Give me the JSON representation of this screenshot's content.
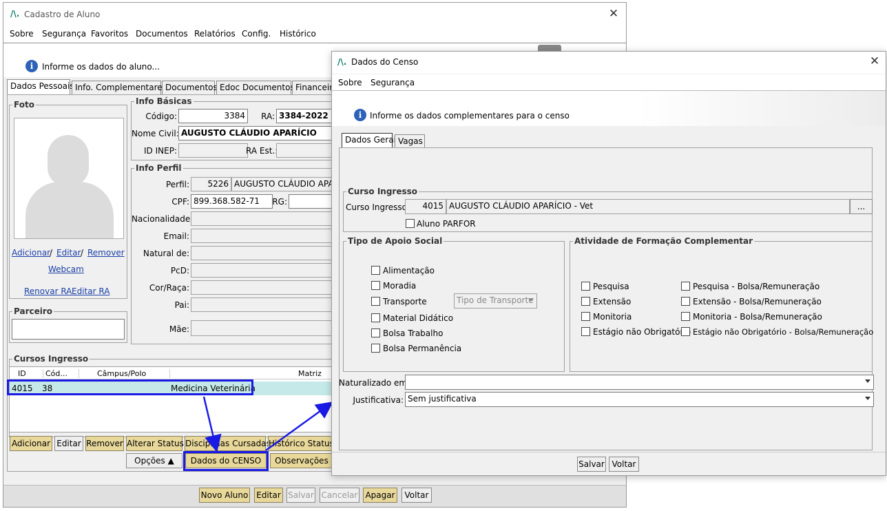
{
  "main_window": {
    "title": "Cadastro de Aluno",
    "menu": [
      "Sobre",
      "Segurança",
      "Favoritos",
      "Documentos",
      "Relatórios",
      "Config.",
      "Histórico"
    ],
    "info_text": "Informe os dados do aluno...",
    "tabs": [
      "Dados Pessoais",
      "Info. Complementares",
      "Documentos",
      "Edoc Documentos",
      "Financeiro"
    ],
    "foto": {
      "title": "Foto",
      "adicionar": "Adicionar",
      "sep1": "/",
      "editar": "Editar",
      "sep2": "/",
      "remover": "Remover",
      "webcam": "Webcam",
      "renovar_ra": "Renovar RA",
      "editar_ra": "Editar RA"
    },
    "parceiro": {
      "title": "Parceiro"
    },
    "info_basicas": {
      "title": "Info Básicas",
      "codigo_label": "Código:",
      "codigo_value": "3384",
      "ra_label": "RA:",
      "ra_value": "3384-2022",
      "nome_label": "Nome Civil:",
      "nome_value": "AUGUSTO CLÁUDIO APARÍCIO",
      "idinep_label": "ID INEP:",
      "raest_label": "RA Est.:"
    },
    "info_perfil": {
      "title": "Info Perfil",
      "perfil_label": "Perfil:",
      "perfil_id": "5226",
      "perfil_nome": "AUGUSTO CLÁUDIO APARÍ",
      "cpf_label": "CPF:",
      "cpf_value": "899.368.582-71",
      "rg_label": "RG:",
      "nacionalidade_label": "Nacionalidade:",
      "email_label": "Email:",
      "natural_label": "Natural de:",
      "pcd_label": "PcD:",
      "cor_label": "Cor/Raça:",
      "pai_label": "Pai:",
      "mae_label": "Mãe:"
    },
    "cursos": {
      "title": "Cursos Ingresso",
      "columns": [
        "ID",
        "Cód...",
        "Câmpus/Polo",
        "Matriz"
      ],
      "row": {
        "id": "4015",
        "cod": "38",
        "campus": "",
        "matriz": "Medicina Veterinária"
      }
    },
    "action_buttons": [
      "Adicionar",
      "Editar",
      "Remover",
      "Alterar Status",
      "Disciplinas Cursadas",
      "Histórico Status"
    ],
    "opcoes": "Opções ▲",
    "dados_censo": "Dados do CENSO",
    "observacoes": "Observações",
    "footer_buttons": [
      "Novo Aluno",
      "Editar",
      "Salvar",
      "Cancelar",
      "Apagar",
      "Voltar"
    ]
  },
  "censo_window": {
    "title": "Dados do Censo",
    "menu": [
      "Sobre",
      "Segurança"
    ],
    "info_text": "Informe os dados complementares para o censo",
    "tabs": [
      "Dados Gerais",
      "Vagas"
    ],
    "curso_ingresso": {
      "title": "Curso Ingresso",
      "label": "Curso Ingresso:",
      "id": "4015",
      "nome": "AUGUSTO CLÁUDIO APARÍCIO - Vet",
      "browse": "...",
      "parfor": "Aluno PARFOR"
    },
    "apoio_social": {
      "title": "Tipo de Apoio Social",
      "items": [
        "Alimentação",
        "Moradia",
        "Transporte",
        "Material Didático",
        "Bolsa Trabalho",
        "Bolsa Permanência"
      ],
      "transporte_placeholder": "Tipo de Transporte"
    },
    "formacao": {
      "title": "Atividade de Formação Complementar",
      "left": [
        "Pesquisa",
        "Extensão",
        "Monitoria",
        "Estágio não Obrigatório"
      ],
      "right": [
        "Pesquisa - Bolsa/Remuneração",
        "Extensão - Bolsa/Remuneração",
        "Monitoria - Bolsa/Remuneração",
        "Estágio não Obrigatório - Bolsa/Remuneração"
      ]
    },
    "naturalizado_label": "Naturalizado em:",
    "naturalizado_value": "",
    "justificativa_label": "Justificativa:",
    "justificativa_value": "Sem justificativa",
    "buttons": [
      "Salvar",
      "Voltar"
    ]
  },
  "colors": {
    "highlight": "#1a1ae6",
    "accent_button": "#e8d89a",
    "link": "#1a3fa8"
  }
}
